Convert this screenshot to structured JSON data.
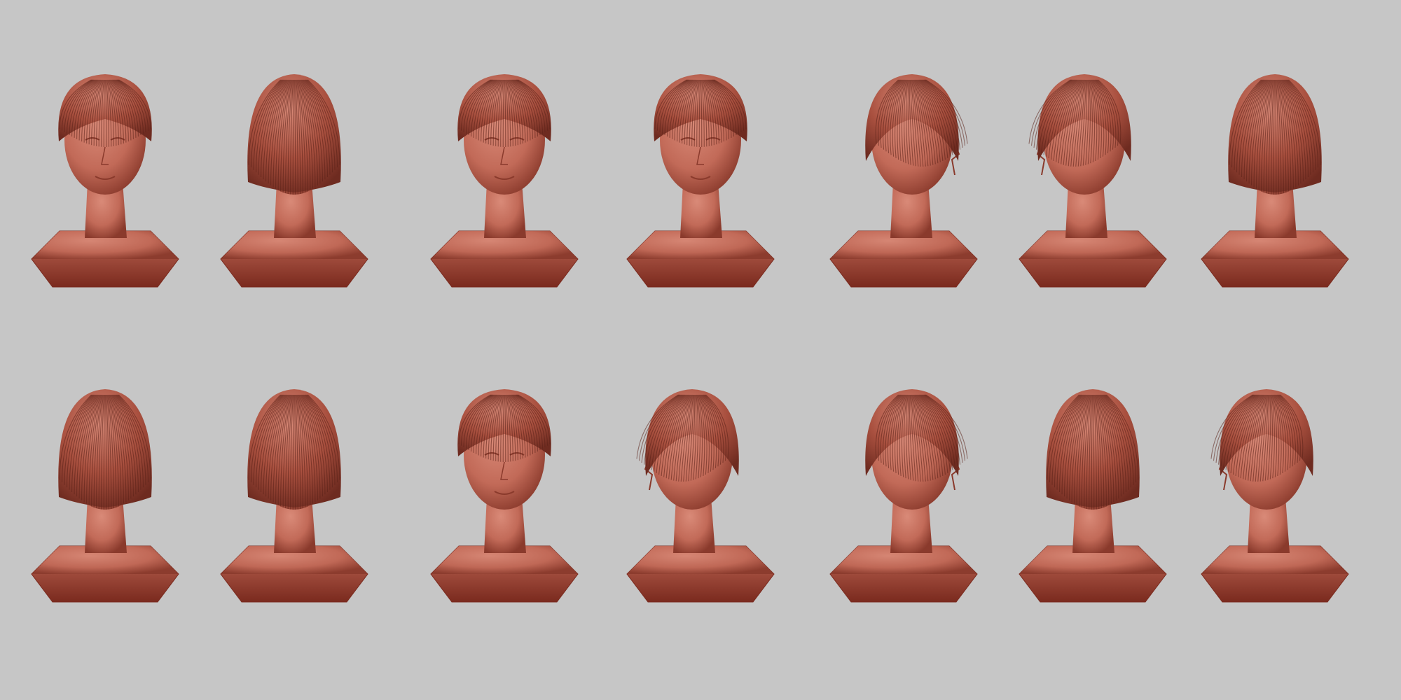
{
  "scene": {
    "background": "#c6c6c6",
    "material": {
      "skin": "#c26a58",
      "skin_light": "#d98a78",
      "skin_dark": "#8a3a2c",
      "hair": "#a9503f",
      "hair_dark": "#6e2b20",
      "base_dark": "#7a2a1e"
    },
    "rows": [
      {
        "views": [
          {
            "view": "front-tilted",
            "hair_stroke": "#5a2018"
          },
          {
            "view": "back-tilted-down",
            "hair_stroke": "#5a2018"
          },
          {
            "view": "front",
            "hair_stroke": "#5a2018"
          },
          {
            "view": "front",
            "hair_stroke": "#5a2018"
          },
          {
            "view": "right-profile",
            "hair_stroke": "#5a2018"
          },
          {
            "view": "left-three-quarter-up",
            "hair_stroke": "#5a2018"
          },
          {
            "view": "back-right",
            "hair_stroke": "#5a2018"
          }
        ]
      },
      {
        "views": [
          {
            "view": "back-left",
            "hair_stroke": "#5a2018"
          },
          {
            "view": "back",
            "hair_stroke": "#5a2018"
          },
          {
            "view": "front-looking-down",
            "hair_stroke": "#5a2018"
          },
          {
            "view": "left-three-quarter-down",
            "hair_stroke": "#5a2018"
          },
          {
            "view": "right-three-quarter",
            "hair_stroke": "#5a2018"
          },
          {
            "view": "back-left-low",
            "hair_stroke": "#5a2018"
          },
          {
            "view": "left-profile",
            "hair_stroke": "#5a2018"
          }
        ]
      }
    ]
  }
}
